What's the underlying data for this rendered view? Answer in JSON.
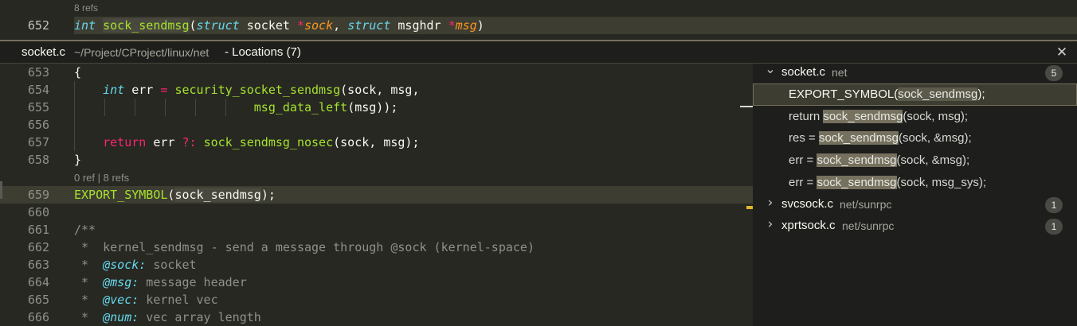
{
  "top_editor": {
    "refs": "8 refs",
    "line_number": "652",
    "tokens": [
      {
        "t": "int",
        "c": "kw"
      },
      {
        "t": " ",
        "c": ""
      },
      {
        "t": "sock_sendmsg",
        "c": "fn hlw"
      },
      {
        "t": "(",
        "c": ""
      },
      {
        "t": "struct",
        "c": "kw"
      },
      {
        "t": " socket ",
        "c": ""
      },
      {
        "t": "*",
        "c": "op"
      },
      {
        "t": "sock",
        "c": "par"
      },
      {
        "t": ", ",
        "c": ""
      },
      {
        "t": "struct",
        "c": "kw"
      },
      {
        "t": " msghdr ",
        "c": ""
      },
      {
        "t": "*",
        "c": "op"
      },
      {
        "t": "msg",
        "c": "par"
      },
      {
        "t": ")",
        "c": ""
      }
    ]
  },
  "peek": {
    "file": "socket.c",
    "path": "~/Project/CProject/linux/net",
    "title": "- Locations (7)",
    "close_icon": "close-icon",
    "codelens": "0 ref | 8 refs",
    "lines": [
      {
        "n": "653",
        "tokens": [
          {
            "t": "{",
            "c": ""
          }
        ]
      },
      {
        "n": "654",
        "tokens": [
          {
            "t": "    ",
            "c": ""
          },
          {
            "t": "int",
            "c": "kw"
          },
          {
            "t": " err ",
            "c": ""
          },
          {
            "t": "=",
            "c": "op"
          },
          {
            "t": " ",
            "c": ""
          },
          {
            "t": "security_socket_sendmsg",
            "c": "fn"
          },
          {
            "t": "(sock, msg,",
            "c": ""
          }
        ]
      },
      {
        "n": "655",
        "tokens": [
          {
            "t": "                         ",
            "c": ""
          },
          {
            "t": "msg_data_left",
            "c": "fn"
          },
          {
            "t": "(msg));",
            "c": ""
          }
        ]
      },
      {
        "n": "656",
        "tokens": []
      },
      {
        "n": "657",
        "tokens": [
          {
            "t": "    ",
            "c": ""
          },
          {
            "t": "return",
            "c": "ret"
          },
          {
            "t": " err ",
            "c": ""
          },
          {
            "t": "?:",
            "c": "op"
          },
          {
            "t": " ",
            "c": ""
          },
          {
            "t": "sock_sendmsg_nosec",
            "c": "fn"
          },
          {
            "t": "(sock, msg);",
            "c": ""
          }
        ]
      },
      {
        "n": "658",
        "tokens": [
          {
            "t": "}",
            "c": ""
          }
        ]
      },
      {
        "n": "659",
        "tokens": [
          {
            "t": "EXPORT_SYMBOL",
            "c": "sym"
          },
          {
            "t": "(",
            "c": ""
          },
          {
            "t": "sock_sendmsg",
            "c": "hlw"
          },
          {
            "t": ");",
            "c": ""
          }
        ]
      },
      {
        "n": "660",
        "tokens": []
      },
      {
        "n": "661",
        "tokens": [
          {
            "t": "/**",
            "c": "cm"
          }
        ]
      },
      {
        "n": "662",
        "tokens": [
          {
            "t": " *  kernel_sendmsg - send a message through @sock (kernel-space)",
            "c": "cm"
          }
        ]
      },
      {
        "n": "663",
        "tokens": [
          {
            "t": " *  ",
            "c": "cm"
          },
          {
            "t": "@sock:",
            "c": "tag"
          },
          {
            "t": " socket",
            "c": "cm"
          }
        ]
      },
      {
        "n": "664",
        "tokens": [
          {
            "t": " *  ",
            "c": "cm"
          },
          {
            "t": "@msg:",
            "c": "tag"
          },
          {
            "t": " message header",
            "c": "cm"
          }
        ]
      },
      {
        "n": "665",
        "tokens": [
          {
            "t": " *  ",
            "c": "cm"
          },
          {
            "t": "@vec:",
            "c": "tag"
          },
          {
            "t": " kernel vec",
            "c": "cm"
          }
        ]
      },
      {
        "n": "666",
        "tokens": [
          {
            "t": " *  ",
            "c": "cm"
          },
          {
            "t": "@num:",
            "c": "tag"
          },
          {
            "t": " vec array length",
            "c": "cm"
          }
        ]
      }
    ]
  },
  "tree": {
    "groups": [
      {
        "file": "socket.c",
        "dir": "net",
        "count": "5",
        "expanded": true,
        "refs": [
          {
            "pre": "EXPORT_SYMBOL(",
            "match": "sock_sendmsg",
            "post": ");"
          },
          {
            "pre": "return ",
            "match": "sock_sendmsg",
            "post": "(sock, msg);"
          },
          {
            "pre": "res = ",
            "match": "sock_sendmsg",
            "post": "(sock, &msg);"
          },
          {
            "pre": "err = ",
            "match": "sock_sendmsg",
            "post": "(sock, &msg);"
          },
          {
            "pre": "err = ",
            "match": "sock_sendmsg",
            "post": "(sock, msg_sys);"
          }
        ]
      },
      {
        "file": "svcsock.c",
        "dir": "net/sunrpc",
        "count": "1",
        "expanded": false,
        "refs": []
      },
      {
        "file": "xprtsock.c",
        "dir": "net/sunrpc",
        "count": "1",
        "expanded": false,
        "refs": []
      }
    ]
  }
}
